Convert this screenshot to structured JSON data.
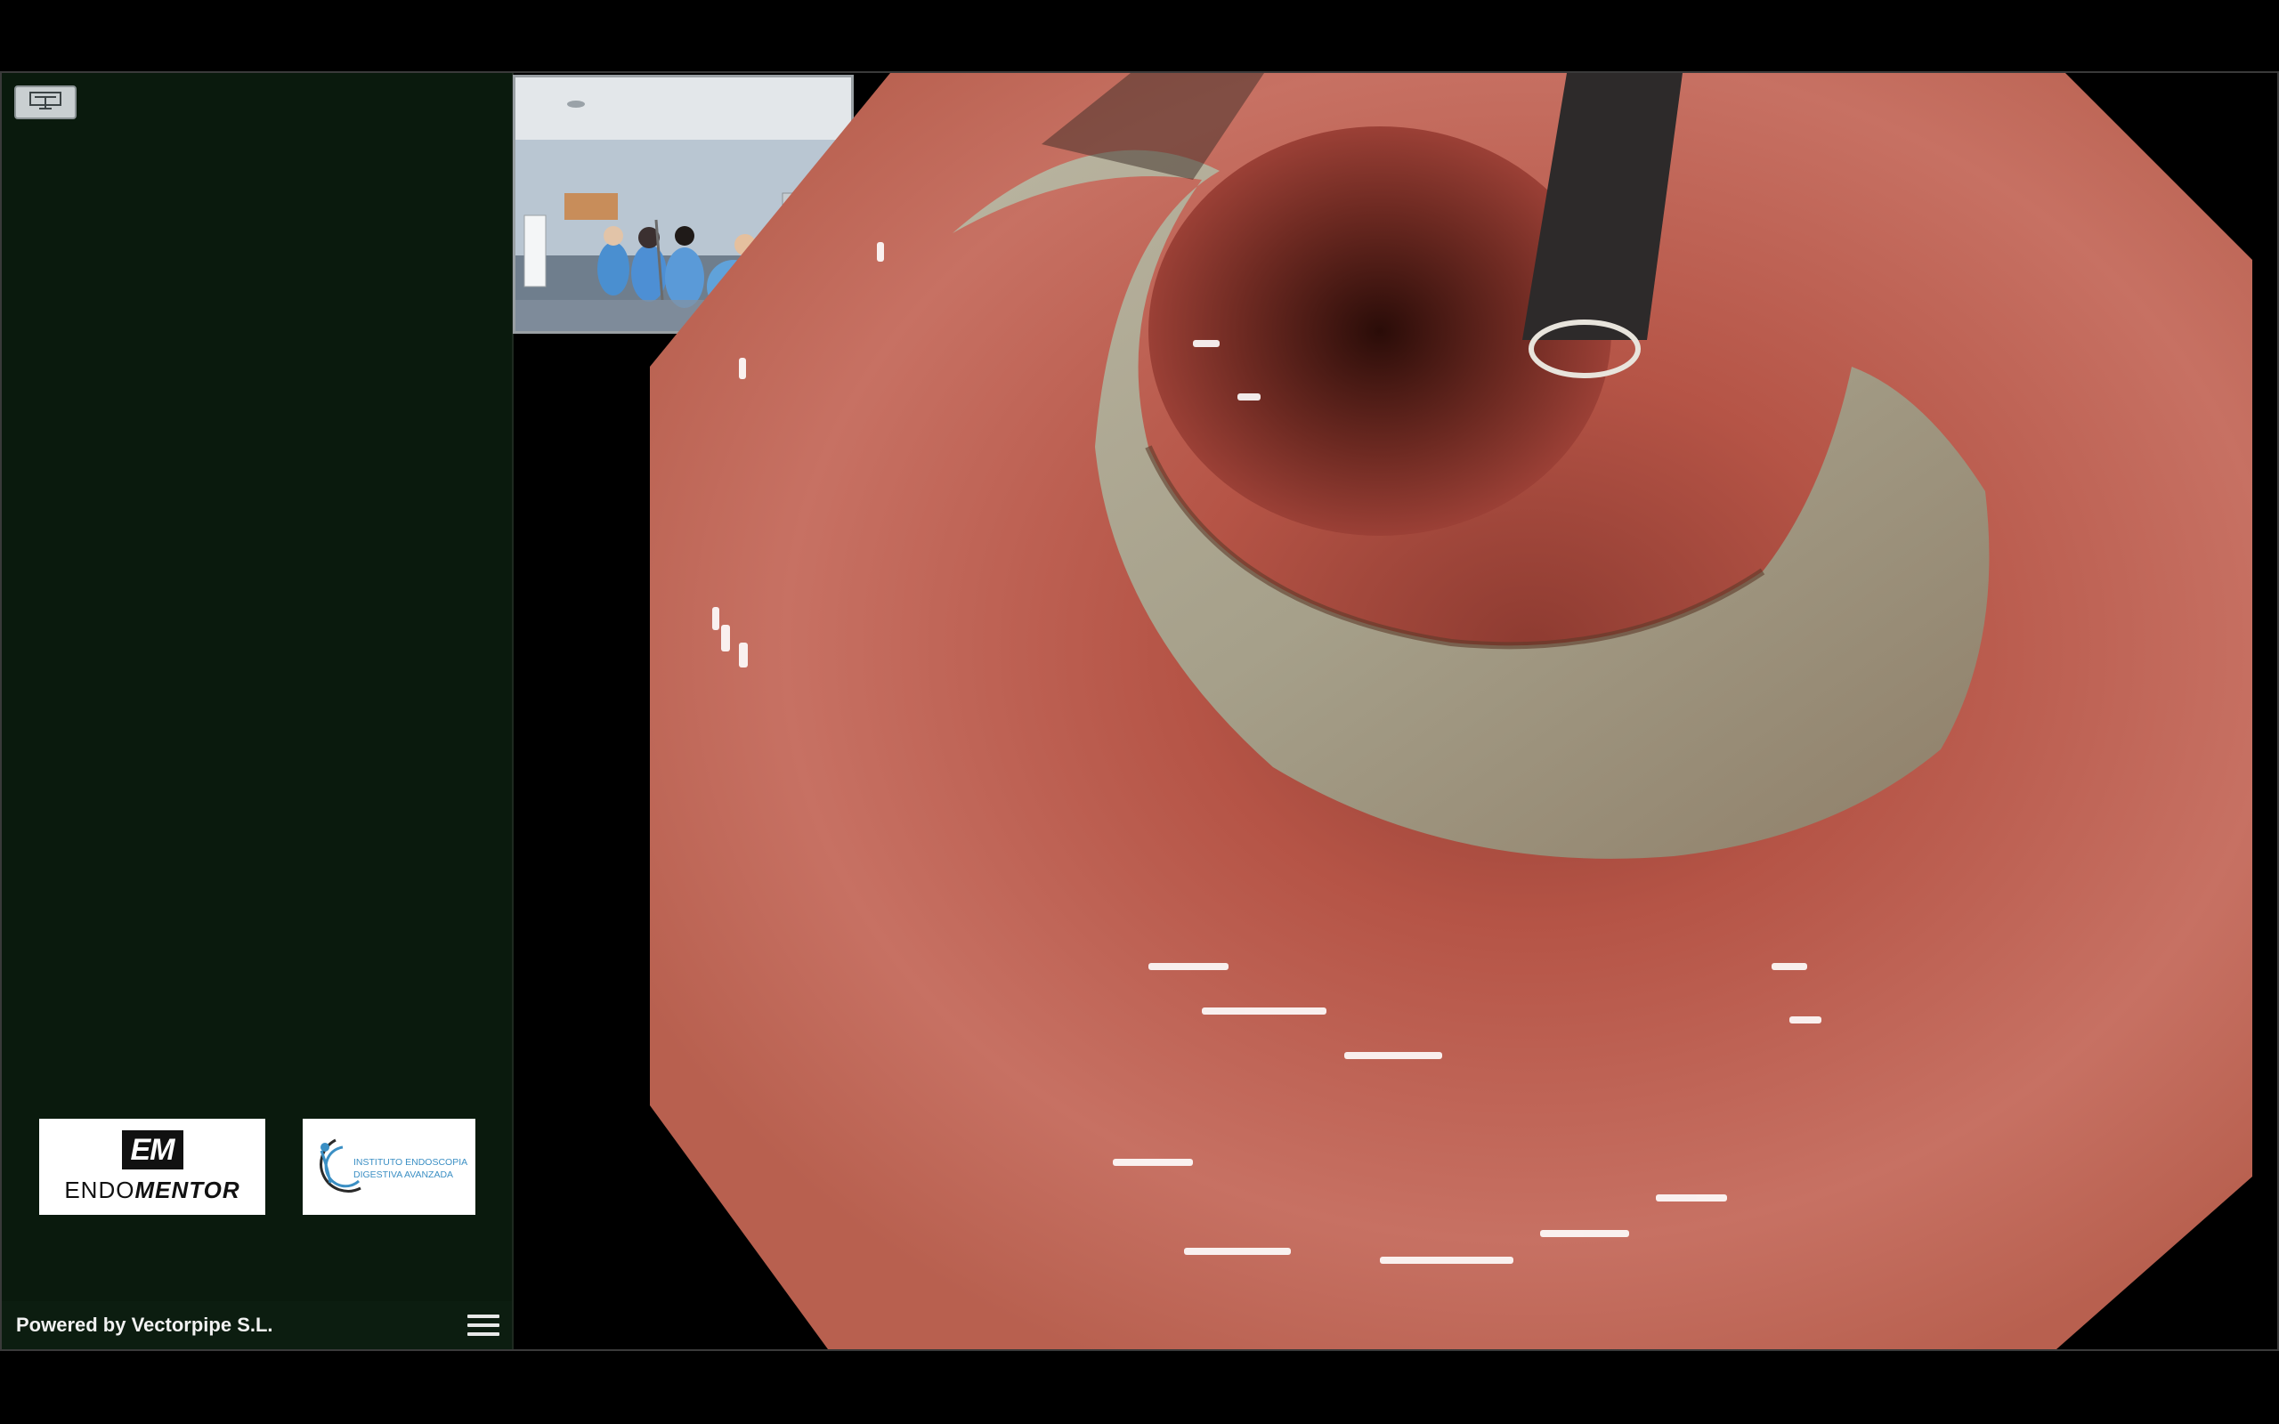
{
  "app": {
    "powered_by": "Powered by Vectorpipe S.L."
  },
  "logos": {
    "endomentor": {
      "mark": "EM",
      "word_prefix": "ENDO",
      "word_suffix": "MENTOR"
    },
    "instituto": {
      "line1": "INSTITUTO ENDOSCOPIA",
      "line2": "DIGESTIVA AVANZADA"
    }
  },
  "icons": {
    "cast_button": "cast-icon",
    "menu": "hamburger-menu-icon"
  },
  "colors": {
    "sidebar_bg": "#0a1a0d",
    "powered_bar_bg": "#0c1d10",
    "mucosa": "#b9554a",
    "lesion": "#a9a18a",
    "instituto_accent": "#3b8fc4"
  }
}
